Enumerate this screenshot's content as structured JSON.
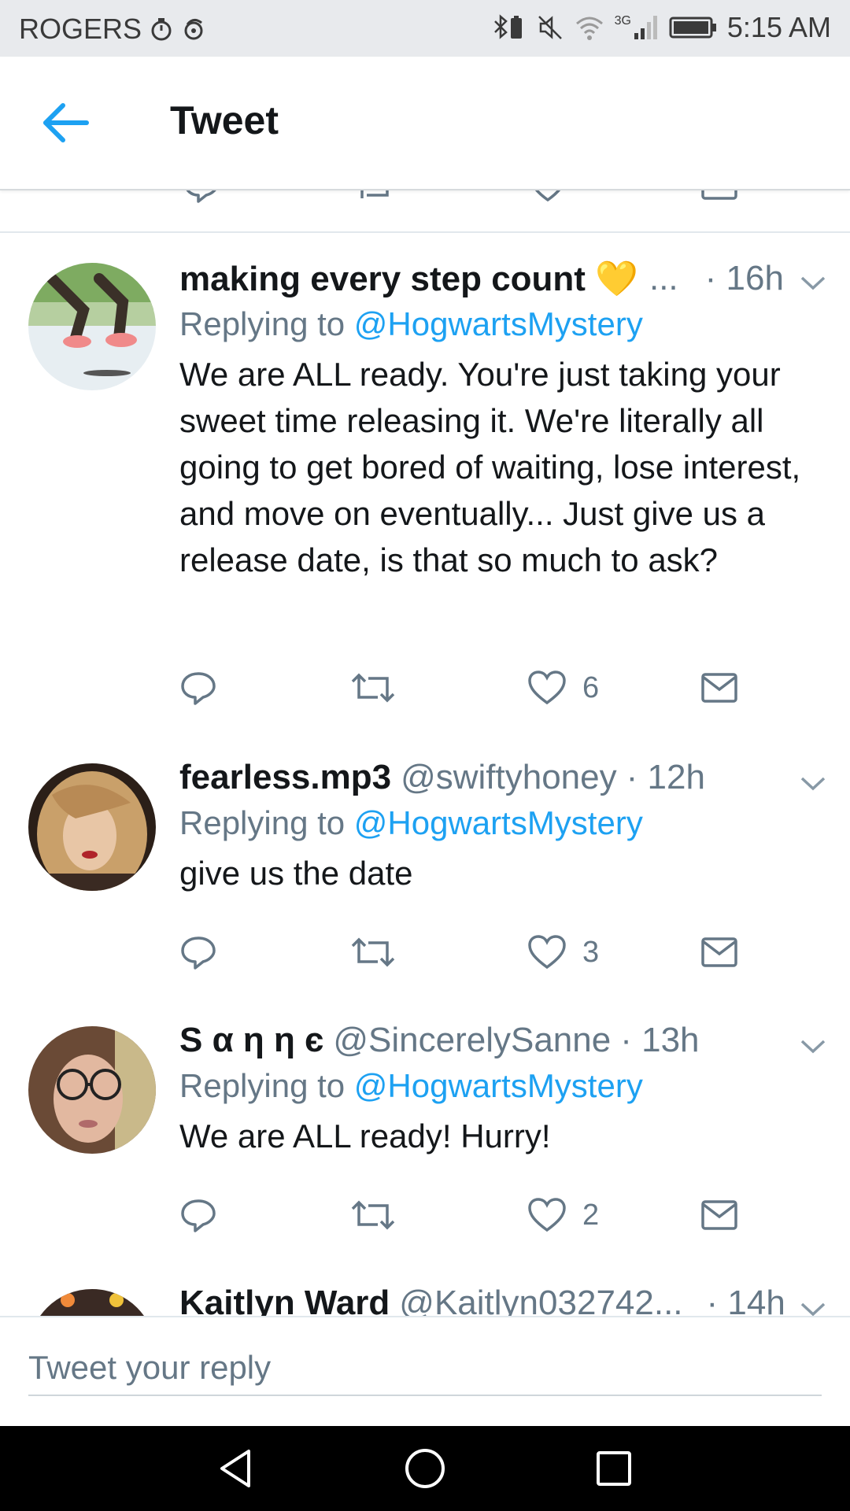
{
  "status_bar": {
    "carrier": "ROGERS",
    "network": "3G",
    "time": "5:15 AM"
  },
  "header": {
    "title": "Tweet",
    "back_icon": "back-arrow-icon"
  },
  "colors": {
    "accent": "#1da1f2",
    "secondary_text": "#657786",
    "primary_text": "#14171a",
    "divider": "#e1e8ed"
  },
  "tweets": [
    {
      "name": "making every step count 💛",
      "name_overflow": "...",
      "handle": "",
      "time": "· 16h",
      "replying_prefix": "Replying to ",
      "replying_to": "@HogwartsMystery",
      "text": "We are ALL ready. You're just taking your sweet time releasing it. We're literally all going to get bored of waiting, lose interest, and move on eventually... Just give us a release date, is that so much to ask?",
      "likes": "6"
    },
    {
      "name": "fearless.mp3",
      "handle": "@swiftyhoney",
      "time": "· 12h",
      "replying_prefix": "Replying to ",
      "replying_to": "@HogwartsMystery",
      "text": "give us the date",
      "likes": "3"
    },
    {
      "name": "S α η η є",
      "handle": "@SincerelySanne",
      "time": "· 13h",
      "replying_prefix": "Replying to ",
      "replying_to": "@HogwartsMystery",
      "text": "We are ALL ready! Hurry!",
      "likes": "2"
    },
    {
      "name": "Kaitlyn Ward",
      "handle": "@Kaitlyn032742...",
      "time": "· 14h"
    }
  ],
  "reply_bar": {
    "placeholder": "Tweet your reply"
  }
}
